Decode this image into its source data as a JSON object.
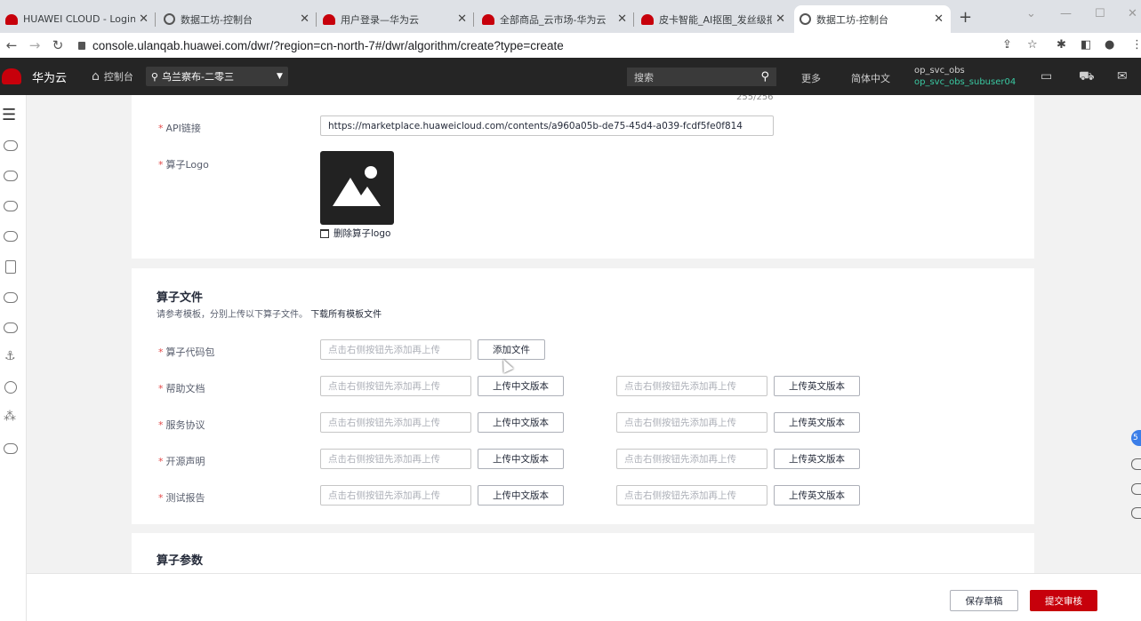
{
  "browser": {
    "tabs": [
      {
        "title": "HUAWEI CLOUD - Login",
        "icon": "huawei-icon",
        "active": false
      },
      {
        "title": "数据工坊-控制台",
        "icon": "globe-icon",
        "active": false
      },
      {
        "title": "用户登录—华为云",
        "icon": "huawei-icon",
        "active": false
      },
      {
        "title": "全部商品_云市场-华为云",
        "icon": "huawei-icon",
        "active": false
      },
      {
        "title": "皮卡智能_AI抠图_发丝级抠",
        "icon": "huawei-icon",
        "active": false
      },
      {
        "title": "数据工坊-控制台",
        "icon": "globe-icon",
        "active": true
      }
    ],
    "url": "console.ulanqab.huawei.com/dwr/?region=cn-north-7#/dwr/algorithm/create?type=create"
  },
  "console": {
    "brand": "华为云",
    "home_label": "控制台",
    "region": "乌兰察布-二零三",
    "search_placeholder": "搜索",
    "more": "更多",
    "language": "简体中文",
    "user_line1": "op_svc_obs",
    "user_line2": "op_svc_obs_subuser04",
    "accent_color": "#c7000b"
  },
  "form": {
    "counter": "255/256",
    "api_link": {
      "label": "API链接",
      "value": "https://marketplace.huaweicloud.com/contents/a960a05b-de75-45d4-a039-fcdf5fe0f814"
    },
    "logo": {
      "label": "算子Logo",
      "delete_label": "删除算子logo"
    },
    "files_section": {
      "title": "算子文件",
      "desc": "请参考模板，分别上传以下算子文件。",
      "download_link": "下载所有模板文件",
      "placeholder": "点击右侧按钮先添加再上传",
      "code_pkg": {
        "label": "算子代码包",
        "button": "添加文件"
      },
      "rows": [
        {
          "label": "帮助文档",
          "cn_button": "上传中文版本",
          "en_button": "上传英文版本"
        },
        {
          "label": "服务协议",
          "cn_button": "上传中文版本",
          "en_button": "上传英文版本"
        },
        {
          "label": "开源声明",
          "cn_button": "上传中文版本",
          "en_button": "上传英文版本"
        },
        {
          "label": "测试报告",
          "cn_button": "上传中文版本",
          "en_button": "上传英文版本"
        }
      ]
    },
    "params_section": {
      "title": "算子参数"
    }
  },
  "footer": {
    "save_draft": "保存草稿",
    "submit": "提交审核"
  },
  "float_badge": "5"
}
